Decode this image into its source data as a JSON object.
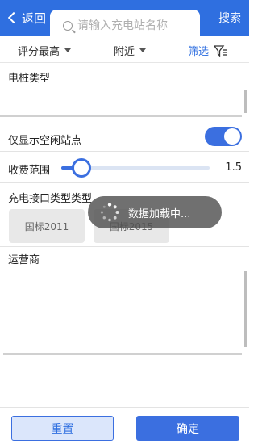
{
  "header": {
    "back_label": "返回",
    "search_placeholder": "请输入充电站名称",
    "search_button": "搜索"
  },
  "filter_bar": {
    "sort_label": "评分最高",
    "distance_label": "附近",
    "screen_label": "筛选"
  },
  "sections": {
    "pile_type_label": "电桩类型",
    "idle_only_label": "仅显示空闲站点",
    "idle_only_on": true,
    "fee_range_label": "收费范围",
    "fee_range_value": "1.5",
    "fee_range_fraction": 0.14,
    "connector_label": "充电接口类型类型",
    "connector_options": [
      "国标2011",
      "国标2015"
    ],
    "operator_label": "运营商"
  },
  "toast": {
    "text": "数据加载中..."
  },
  "footer": {
    "reset_label": "重置",
    "confirm_label": "确定"
  },
  "colors": {
    "primary": "#2f6fe0",
    "toggle_on": "#3b6fe0",
    "chip_bg": "#e8e8e8"
  }
}
